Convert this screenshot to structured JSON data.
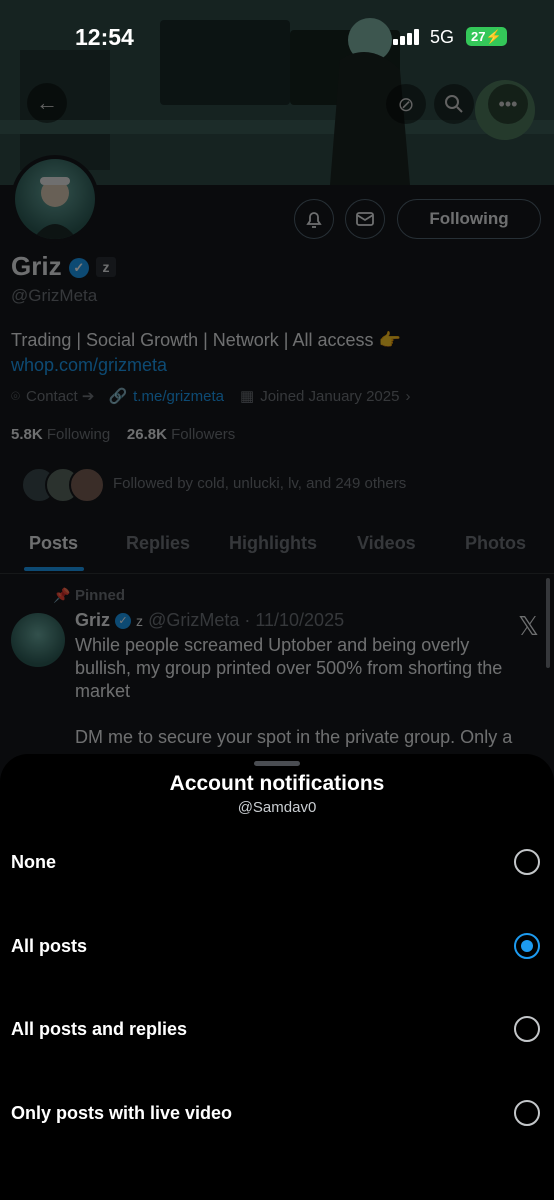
{
  "status_bar": {
    "time": "12:54",
    "network": "5G",
    "battery": "27"
  },
  "profile": {
    "name": "Griz",
    "handle": "@GrizMeta",
    "affiliate_badge": "z",
    "follow_button": "Following",
    "bio_text": "Trading | Social Growth | Network | All access 👉 ",
    "bio_link": "whop.com/grizmeta",
    "contact": "Contact ➔",
    "website": "t.me/grizmeta",
    "joined": "Joined January 2025",
    "following_count": "5.8K",
    "following_label": "Following",
    "followers_count": "26.8K",
    "followers_label": "Followers",
    "followed_by": "Followed by cold, unlucki, lv, and 249 others"
  },
  "tabs": [
    "Posts",
    "Replies",
    "Highlights",
    "Videos",
    "Photos"
  ],
  "post": {
    "pinned_label": "Pinned",
    "author": "Griz",
    "meta": "@GrizMeta · 11/10/2025",
    "text_1": "While people screamed Uptober and being overly bullish, my group printed over 500% from shorting the market",
    "text_2": "DM me to secure your spot in the private group. Only a"
  },
  "sheet": {
    "title": "Account notifications",
    "subtitle": "@Samdav0",
    "options": [
      {
        "label": "None",
        "selected": false
      },
      {
        "label": "All posts",
        "selected": true
      },
      {
        "label": "All posts and replies",
        "selected": false
      },
      {
        "label": "Only posts with live video",
        "selected": false
      }
    ]
  },
  "colors": {
    "accent": "#1d9bf0",
    "sheet_bg": "#000000",
    "page_bg": "#15181c"
  }
}
